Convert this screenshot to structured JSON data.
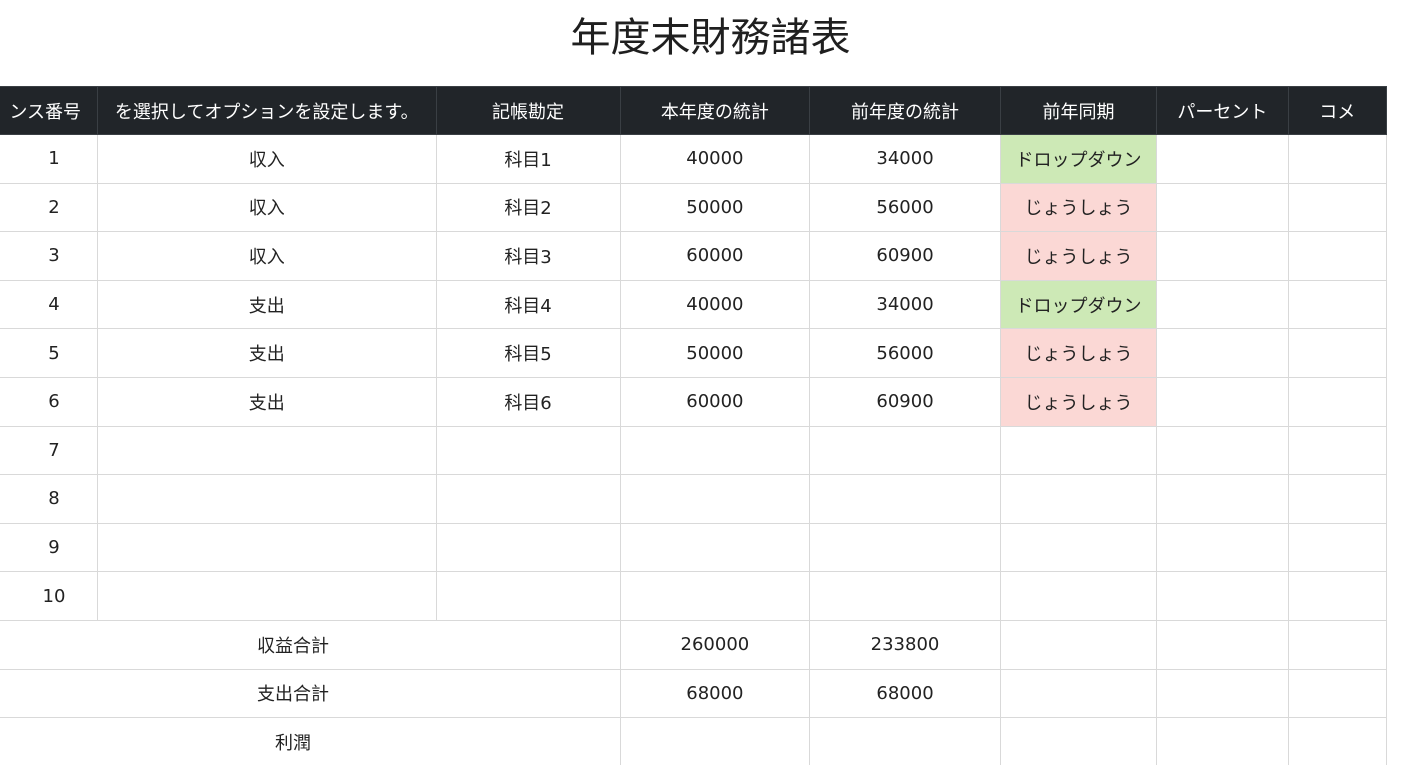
{
  "title": "年度末財務諸表",
  "headers": [
    "ンス番号",
    "を選択してオプションを設定します。",
    "記帳勘定",
    "本年度の統計",
    "前年度の統計",
    "前年同期",
    "パーセント",
    "コメ"
  ],
  "rows": [
    {
      "no": "1",
      "type": "収入",
      "account": "科目1",
      "current": "40000",
      "previous": "34000",
      "yoy": "ドロップダウン",
      "yoy_status": "pos"
    },
    {
      "no": "2",
      "type": "収入",
      "account": "科目2",
      "current": "50000",
      "previous": "56000",
      "yoy": "じょうしょう",
      "yoy_status": "neg"
    },
    {
      "no": "3",
      "type": "収入",
      "account": "科目3",
      "current": "60000",
      "previous": "60900",
      "yoy": "じょうしょう",
      "yoy_status": "neg"
    },
    {
      "no": "4",
      "type": "支出",
      "account": "科目4",
      "current": "40000",
      "previous": "34000",
      "yoy": "ドロップダウン",
      "yoy_status": "pos"
    },
    {
      "no": "5",
      "type": "支出",
      "account": "科目5",
      "current": "50000",
      "previous": "56000",
      "yoy": "じょうしょう",
      "yoy_status": "neg"
    },
    {
      "no": "6",
      "type": "支出",
      "account": "科目6",
      "current": "60000",
      "previous": "60900",
      "yoy": "じょうしょう",
      "yoy_status": "neg"
    },
    {
      "no": "7",
      "type": "",
      "account": "",
      "current": "",
      "previous": "",
      "yoy": "",
      "yoy_status": ""
    },
    {
      "no": "8",
      "type": "",
      "account": "",
      "current": "",
      "previous": "",
      "yoy": "",
      "yoy_status": ""
    },
    {
      "no": "9",
      "type": "",
      "account": "",
      "current": "",
      "previous": "",
      "yoy": "",
      "yoy_status": ""
    },
    {
      "no": "10",
      "type": "",
      "account": "",
      "current": "",
      "previous": "",
      "yoy": "",
      "yoy_status": ""
    }
  ],
  "summary": [
    {
      "label": "収益合計",
      "current": "260000",
      "previous": "233800"
    },
    {
      "label": "支出合計",
      "current": "68000",
      "previous": "68000"
    },
    {
      "label": "利潤",
      "current": "",
      "previous": ""
    }
  ],
  "colors": {
    "header_bg": "#212529",
    "header_text": "#ffffff",
    "positive_bg": "#cde9b6",
    "negative_bg": "#fbd8d5",
    "grid_line": "#d9d9d9"
  }
}
